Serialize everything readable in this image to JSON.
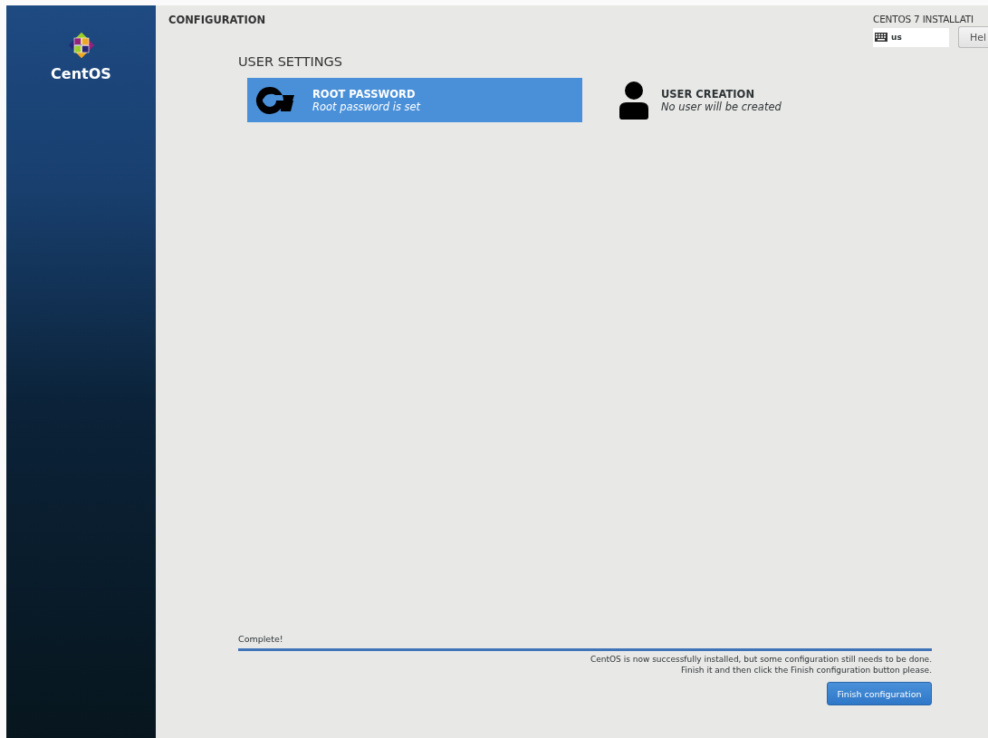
{
  "sidebar": {
    "brand": "CentOS"
  },
  "header": {
    "title": "CONFIGURATION",
    "product": "CENTOS 7 INSTALLATI",
    "keyboard_layout": "us",
    "help_button": "Hel"
  },
  "hub": {
    "heading": "USER SETTINGS",
    "spokes": [
      {
        "kind": "key",
        "title": "ROOT PASSWORD",
        "status": "Root password is set",
        "selected": true
      },
      {
        "kind": "user",
        "title": "USER CREATION",
        "status": "No user will be created",
        "selected": false
      }
    ]
  },
  "progress": {
    "label": "Complete!",
    "level": 1
  },
  "messages": [
    "CentOS is now successfully installed, but some configuration still needs to be done.",
    "Finish it and then click the Finish configuration button please."
  ],
  "finish_button": "Finish configuration"
}
